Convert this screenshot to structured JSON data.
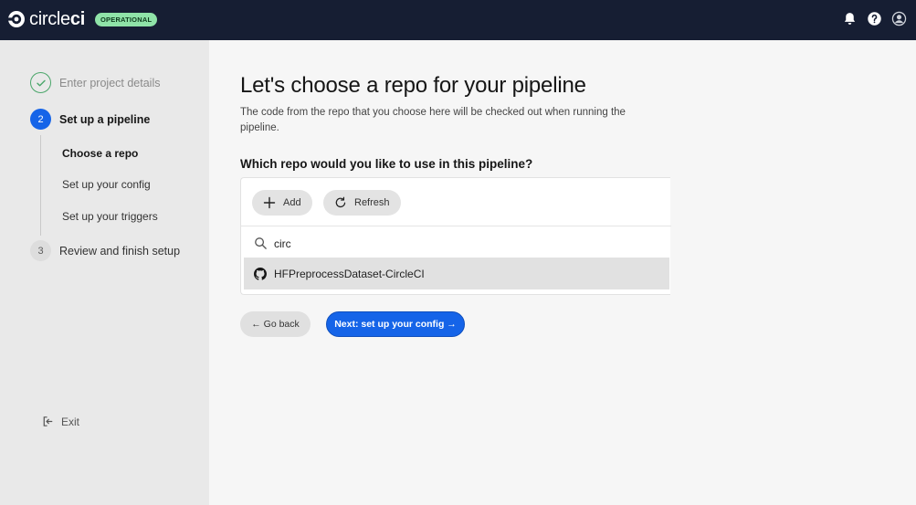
{
  "header": {
    "logo_text_light": "circle",
    "logo_text_bold": "ci",
    "status_badge": "OPERATIONAL",
    "icons": [
      "bell-icon",
      "help-icon",
      "user-icon"
    ],
    "colors": {
      "bar": "#161e33",
      "badge": "#8fe3a8",
      "accent": "#1564e8"
    }
  },
  "sidebar": {
    "steps": [
      {
        "number": "",
        "label": "Enter project details",
        "state": "done"
      },
      {
        "number": "2",
        "label": "Set up a pipeline",
        "state": "active"
      },
      {
        "number": "3",
        "label": "Review and finish setup",
        "state": "pending"
      }
    ],
    "substeps": [
      {
        "label": "Choose a repo",
        "current": true
      },
      {
        "label": "Set up your config",
        "current": false
      },
      {
        "label": "Set up your triggers",
        "current": false
      }
    ],
    "exit_label": "Exit"
  },
  "main": {
    "title": "Let's choose a repo for your pipeline",
    "description": "The code from the repo that you choose here will be checked out when running the pipeline.",
    "question": "Which repo would you like to use in this pipeline?",
    "add_label": "Add",
    "refresh_label": "Refresh",
    "search_value": "circ",
    "repos": [
      {
        "name": "HFPreprocessDataset-CircleCI",
        "icon": "github-icon"
      }
    ],
    "back_label": "← Go back",
    "next_label": "Next: set up your config →"
  }
}
